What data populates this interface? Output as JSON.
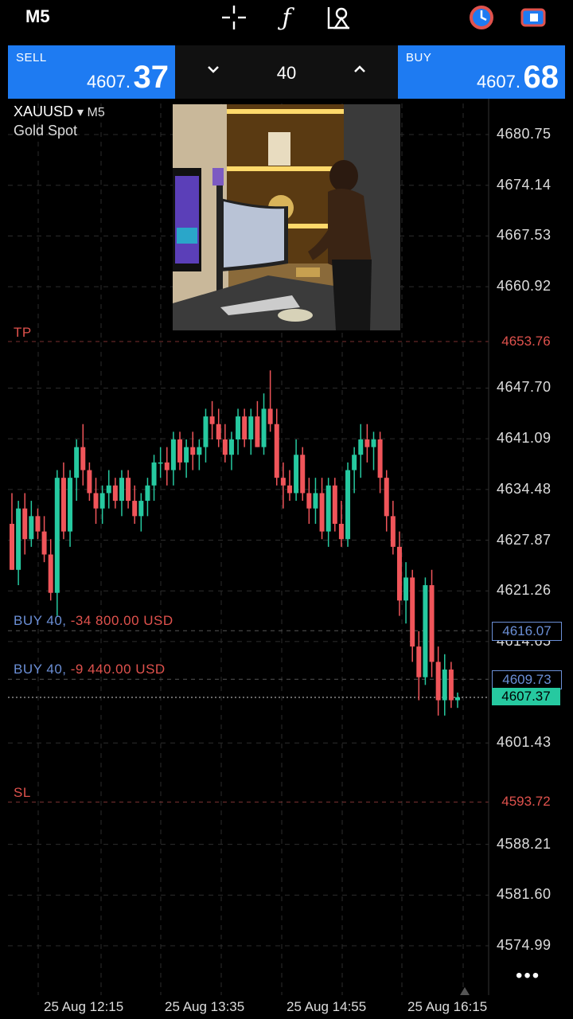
{
  "header": {
    "timeframe": "M5",
    "icons": [
      "crosshair-icon",
      "function-icon",
      "objects-icon",
      "timer-icon",
      "trade-toggle-icon"
    ]
  },
  "trade_panel": {
    "sell_label": "SELL",
    "sell_price_main": "4607.",
    "sell_price_big": "37",
    "buy_label": "BUY",
    "buy_price_main": "4607.",
    "buy_price_big": "68",
    "volume": "40",
    "colors": {
      "button": "#1e7bf2"
    }
  },
  "chart_info": {
    "symbol": "XAUUSD",
    "symbol_tf": "M5",
    "description": "Gold Spot"
  },
  "price_axis": [
    "4680.75",
    "4674.14",
    "4667.53",
    "4660.92",
    "4647.70",
    "4641.09",
    "4634.48",
    "4627.87",
    "4621.26",
    "4614.65",
    "4601.43",
    "4588.21",
    "4581.60",
    "4574.99"
  ],
  "levels": {
    "tp": {
      "label": "TP",
      "price": "4653.76",
      "color": "#e0524d"
    },
    "sl": {
      "label": "SL",
      "price": "4593.72",
      "color": "#e0524d"
    },
    "pos1": {
      "label_side": "BUY 40,",
      "label_pl": "-34 800.00 USD",
      "price": "4616.07"
    },
    "pos2": {
      "label_side": "BUY 40,",
      "label_pl": "-9 440.00 USD",
      "price": "4609.73"
    },
    "bid": {
      "price": "4607.37",
      "color": "#26c9a0"
    }
  },
  "time_axis": [
    "25 Aug 12:15",
    "25 Aug 13:35",
    "25 Aug 14:55",
    "25 Aug 16:15"
  ],
  "more_icon": "more-dots-icon",
  "chart_data": {
    "type": "candlestick",
    "ylim": [
      4571.69,
      4684.05
    ],
    "colors": {
      "up": "#26c9a0",
      "down": "#f0555a"
    },
    "candles": [
      [
        4630,
        4634,
        4624,
        4624
      ],
      [
        4624,
        4633,
        4622,
        4632
      ],
      [
        4632,
        4634,
        4626,
        4628
      ],
      [
        4628,
        4633,
        4627,
        4631
      ],
      [
        4631,
        4632,
        4628,
        4629
      ],
      [
        4629,
        4631,
        4625,
        4626
      ],
      [
        4626,
        4628,
        4620,
        4621
      ],
      [
        4621,
        4637,
        4618,
        4636
      ],
      [
        4636,
        4638,
        4628,
        4629
      ],
      [
        4629,
        4637,
        4627,
        4636
      ],
      [
        4636,
        4641,
        4633,
        4640
      ],
      [
        4640,
        4643,
        4635,
        4637
      ],
      [
        4637,
        4638,
        4633,
        4634
      ],
      [
        4634,
        4636,
        4630,
        4632
      ],
      [
        4632,
        4635,
        4630,
        4634
      ],
      [
        4634,
        4637,
        4632,
        4635
      ],
      [
        4635,
        4636,
        4632,
        4633
      ],
      [
        4633,
        4637,
        4631,
        4636
      ],
      [
        4636,
        4637,
        4632,
        4633
      ],
      [
        4633,
        4635,
        4630,
        4631
      ],
      [
        4631,
        4634,
        4629,
        4633
      ],
      [
        4633,
        4636,
        4631,
        4635
      ],
      [
        4635,
        4639,
        4633,
        4638
      ],
      [
        4638,
        4640,
        4636,
        4638
      ],
      [
        4638,
        4640,
        4635,
        4637
      ],
      [
        4637,
        4642,
        4635,
        4641
      ],
      [
        4641,
        4642,
        4637,
        4638
      ],
      [
        4638,
        4641,
        4636,
        4640
      ],
      [
        4640,
        4642,
        4637,
        4639
      ],
      [
        4639,
        4641,
        4637,
        4640
      ],
      [
        4640,
        4645,
        4638,
        4644
      ],
      [
        4644,
        4646,
        4641,
        4643
      ],
      [
        4643,
        4645,
        4640,
        4641
      ],
      [
        4641,
        4643,
        4638,
        4639
      ],
      [
        4639,
        4642,
        4637,
        4641
      ],
      [
        4641,
        4645,
        4639,
        4644
      ],
      [
        4644,
        4645,
        4640,
        4641
      ],
      [
        4641,
        4645,
        4639,
        4644
      ],
      [
        4644,
        4646,
        4640,
        4640
      ],
      [
        4640,
        4647,
        4639,
        4645
      ],
      [
        4645,
        4650,
        4642,
        4643
      ],
      [
        4643,
        4645,
        4635,
        4636
      ],
      [
        4636,
        4638,
        4632,
        4635
      ],
      [
        4635,
        4637,
        4633,
        4634
      ],
      [
        4634,
        4641,
        4633,
        4639
      ],
      [
        4639,
        4640,
        4633,
        4634
      ],
      [
        4634,
        4636,
        4630,
        4632
      ],
      [
        4632,
        4636,
        4630,
        4634
      ],
      [
        4634,
        4636,
        4628,
        4629
      ],
      [
        4629,
        4636,
        4627,
        4635
      ],
      [
        4635,
        4636,
        4629,
        4630
      ],
      [
        4630,
        4633,
        4627,
        4628
      ],
      [
        4628,
        4638,
        4627,
        4637
      ],
      [
        4637,
        4640,
        4634,
        4639
      ],
      [
        4639,
        4643,
        4636,
        4641
      ],
      [
        4641,
        4643,
        4638,
        4640
      ],
      [
        4640,
        4642,
        4637,
        4641
      ],
      [
        4641,
        4642,
        4634,
        4636
      ],
      [
        4636,
        4637,
        4629,
        4631
      ],
      [
        4631,
        4633,
        4626,
        4627
      ],
      [
        4627,
        4629,
        4618,
        4620
      ],
      [
        4620,
        4625,
        4617,
        4623
      ],
      [
        4623,
        4624,
        4612,
        4614
      ],
      [
        4614,
        4616,
        4607,
        4610
      ],
      [
        4610,
        4623,
        4609,
        4622
      ],
      [
        4622,
        4624,
        4610,
        4612
      ],
      [
        4612,
        4614,
        4605,
        4607
      ],
      [
        4607,
        4613,
        4605,
        4611
      ],
      [
        4611,
        4612,
        4606,
        4607
      ],
      [
        4607,
        4608,
        4606,
        4607.37
      ]
    ]
  }
}
